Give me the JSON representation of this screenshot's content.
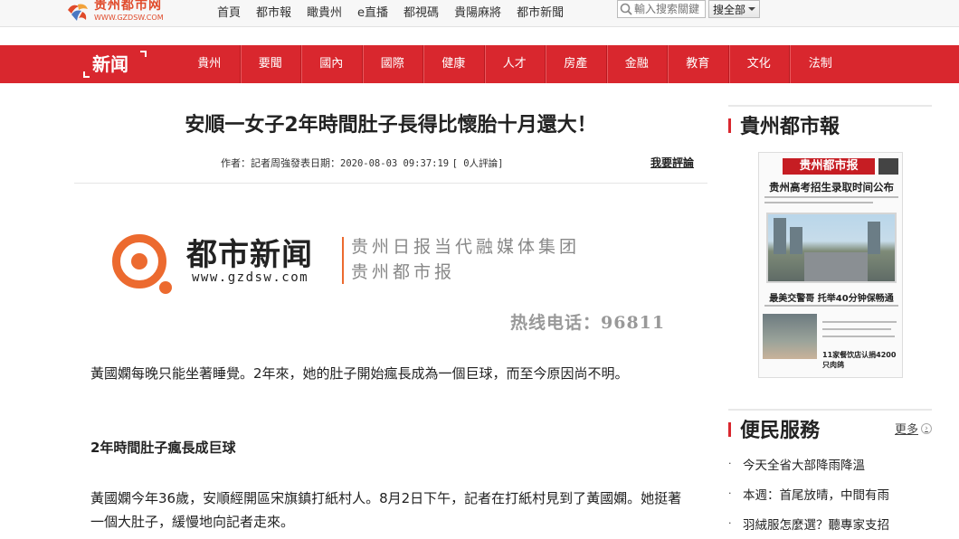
{
  "site": {
    "logo_name": "贵州都市网",
    "logo_url": "WWW.GZDSW.COM",
    "accent_color": "#d9272e",
    "logo_color": "#e04a2a"
  },
  "topnav": {
    "items": [
      "首頁",
      "都市報",
      "瞰貴州",
      "e直播",
      "都視碼",
      "貴陽麻將",
      "都市新聞"
    ]
  },
  "search": {
    "placeholder": "輸入搜索關鍵",
    "scope": "搜全部"
  },
  "section": {
    "title": "新闻",
    "categories": [
      "貴州",
      "要聞",
      "國內",
      "國際",
      "健康",
      "人才",
      "房產",
      "金融",
      "教育",
      "文化",
      "法制"
    ]
  },
  "article": {
    "headline": "安順一女子2年時間肚子長得比懷胎十月還大！",
    "meta_author": "作者：記者周強",
    "meta_date_label": "發表日期：",
    "meta_date": "2020-08-03 09:37:19",
    "meta_comments": "[ 0人評論]",
    "comment_link": "我要評論",
    "banner": {
      "brand": "都市新闻",
      "brand_url": "www.gzdsw.com",
      "org_line1": "贵州日报当代融媒体集团",
      "org_line2": "贵州都市报",
      "hotline": "热线电话：96811",
      "brand_color": "#ec6a2f"
    },
    "paragraph1": "黃國嫻每晚只能坐著睡覺。2年來，她的肚子開始瘋長成為一個巨球，而至今原因尚不明。",
    "subheading": "2年時間肚子瘋長成巨球",
    "paragraph2": "黃國嫻今年36歲，安順經開區宋旗鎮打紙村人。8月2日下午，記者在打紙村見到了黃國嫻。她挺著一個大肚子，緩慢地向記者走來。"
  },
  "sidebar": {
    "paper_title": "貴州都市報",
    "paper_masthead": "贵州都市报",
    "paper_headline": "贵州高考招生录取时间公布",
    "paper_headline2": "最美交警哥 托举40分钟保畅通",
    "paper_headline3": "11家餐饮店认捐4200只肉鸽",
    "services_title": "便民服務",
    "more_label": "更多",
    "services": [
      "今天全省大部降雨降溫",
      "本週：首尾放晴，中間有雨",
      "羽絨服怎麼選？聽專家支招"
    ]
  }
}
